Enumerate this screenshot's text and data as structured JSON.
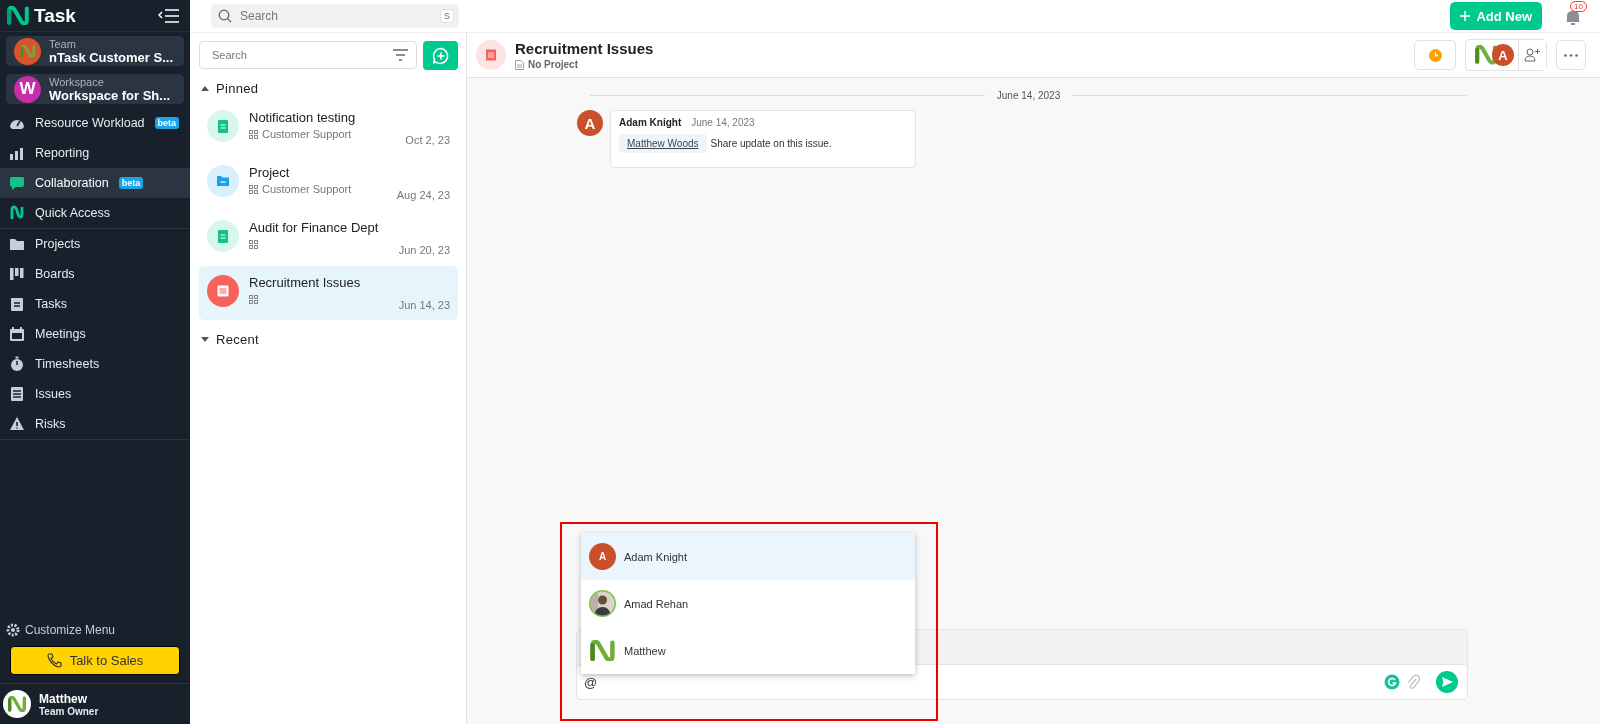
{
  "app": {
    "logo": "Task"
  },
  "topbar": {
    "search_placeholder": "Search",
    "shortcut": "S",
    "add_new": "Add New",
    "notification_count": "10"
  },
  "switchers": [
    {
      "label": "Team",
      "value": "nTask Customer S...",
      "kind": "logo"
    },
    {
      "label": "Workspace",
      "value": "Workspace for Sh...",
      "kind": "letter",
      "letter": "W"
    }
  ],
  "nav_groups": [
    [
      {
        "label": "Resource Workload",
        "kind": "gauge",
        "badge": "beta",
        "selected": false
      },
      {
        "label": "Reporting",
        "kind": "chart",
        "selected": false
      },
      {
        "label": "Collaboration",
        "kind": "chat",
        "badge": "beta",
        "selected": true
      },
      {
        "label": "Quick Access",
        "kind": "logo",
        "selected": false
      }
    ],
    [
      {
        "label": "Projects",
        "kind": "folder",
        "selected": false
      },
      {
        "label": "Boards",
        "kind": "board",
        "selected": false
      },
      {
        "label": "Tasks",
        "kind": "clipboard",
        "selected": false
      },
      {
        "label": "Meetings",
        "kind": "calendar",
        "selected": false
      },
      {
        "label": "Timesheets",
        "kind": "stopwatch",
        "selected": false
      },
      {
        "label": "Issues",
        "kind": "list",
        "selected": false
      },
      {
        "label": "Risks",
        "kind": "warning",
        "selected": false
      }
    ]
  ],
  "customize": "Customize Menu",
  "talk_to_sales": "Talk to Sales",
  "user": {
    "name": "Matthew",
    "role": "Team Owner"
  },
  "chat_list": {
    "search_placeholder": "Search",
    "sections": [
      {
        "title": "Pinned",
        "expanded": true,
        "items": [
          {
            "title": "Notification testing",
            "project": "Customer Support",
            "date": "Oct 2, 23",
            "kind": "task",
            "selected": false
          },
          {
            "title": "Project",
            "project": "Customer Support",
            "date": "Aug 24, 23",
            "kind": "project",
            "selected": false
          },
          {
            "title": "Audit for Finance Dept",
            "date": "Jun 20, 23",
            "kind": "task",
            "selected": false
          },
          {
            "title": "Recruitment Issues",
            "date": "Jun 14, 23",
            "kind": "issue",
            "selected": true
          }
        ]
      },
      {
        "title": "Recent",
        "expanded": false
      }
    ]
  },
  "chat": {
    "title": "Recruitment Issues",
    "project": "No Project",
    "date_divider": "June 14, 2023",
    "messages": [
      {
        "initial": "A",
        "author": "Adam Knight",
        "time": "June 14, 2023",
        "mention": "Matthew Woods",
        "text": "Share update on this issue."
      }
    ],
    "member_initial": "A",
    "mention_menu": [
      {
        "name": "Adam Knight",
        "kind": "initial",
        "initial": "A",
        "selected": true
      },
      {
        "name": "Amad Rehan",
        "selected": false
      },
      {
        "name": "Matthew",
        "kind": "logo",
        "selected": false
      }
    ],
    "composer": {
      "value": "@"
    }
  }
}
